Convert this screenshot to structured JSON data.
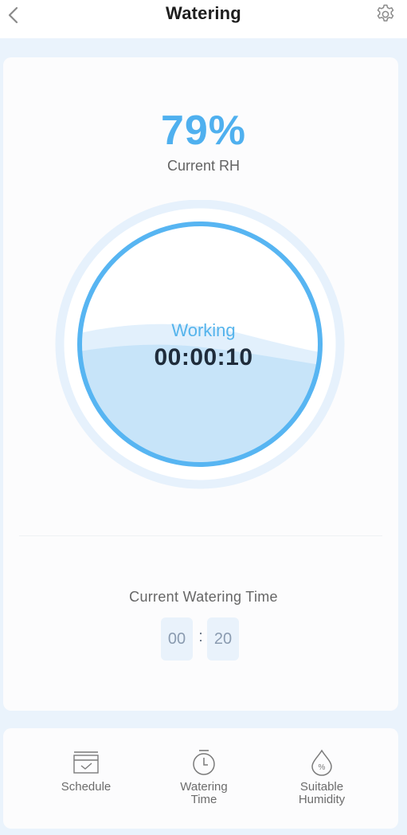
{
  "header": {
    "title": "Watering"
  },
  "humidity": {
    "value": "79%",
    "label": "Current RH"
  },
  "gauge": {
    "status": "Working",
    "elapsed": "00:00:10",
    "fill_level": 0.5,
    "ring_color": "#57b5f2",
    "water_color": "#c7e4f9"
  },
  "watering_time": {
    "label": "Current Watering Time",
    "minutes": "00",
    "separator": ":",
    "seconds": "20"
  },
  "bottom_nav": {
    "items": [
      {
        "icon": "calendar-check-icon",
        "label": "Schedule"
      },
      {
        "icon": "stopwatch-icon",
        "label": "Watering\nTime"
      },
      {
        "icon": "humidity-drop-icon",
        "label": "Suitable\nHumidity"
      }
    ]
  },
  "colors": {
    "accent": "#4fb0ef",
    "background": "#eaf3fc",
    "card": "#fcfcfd"
  }
}
